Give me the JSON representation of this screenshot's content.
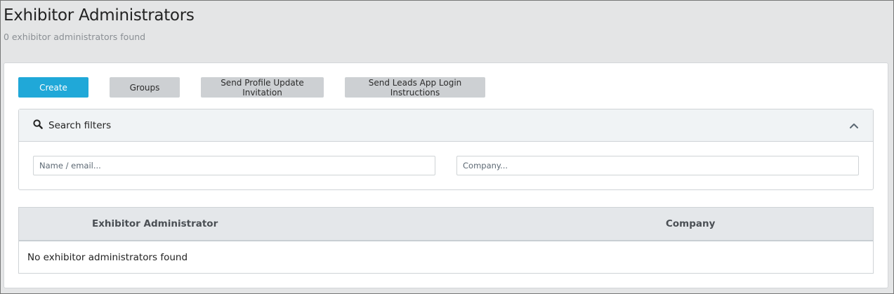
{
  "header": {
    "title": "Exhibitor Administrators",
    "subtitle": "0 exhibitor administrators found"
  },
  "toolbar": {
    "create_label": "Create",
    "groups_label": "Groups",
    "send_profile_label": "Send Profile Update Invitation",
    "send_leads_label": "Send Leads App Login Instructions"
  },
  "filters": {
    "title": "Search filters",
    "search_icon": "search-icon",
    "collapse_icon": "chevron-up-icon",
    "name_placeholder": "Name / email...",
    "name_value": "",
    "company_placeholder": "Company...",
    "company_value": ""
  },
  "table": {
    "columns": [
      "Exhibitor Administrator",
      "Company"
    ],
    "empty_message": "No exhibitor administrators found"
  },
  "colors": {
    "primary": "#20a8d8",
    "secondary_button": "#cdd0d3",
    "background": "#e4e5e6"
  }
}
